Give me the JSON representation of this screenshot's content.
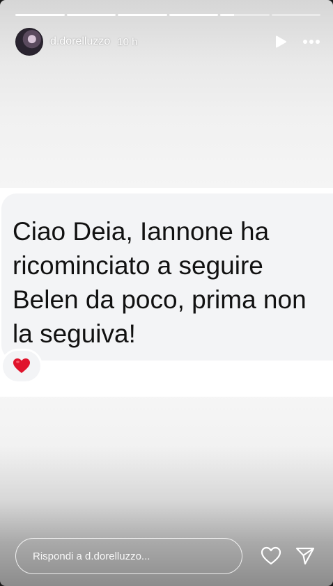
{
  "story": {
    "progress_segments": [
      1,
      1,
      1,
      1,
      0.28,
      0
    ],
    "user": {
      "username": "d.dorelluzzo",
      "time_ago": "10 h"
    },
    "message": {
      "text": "Ciao Deia, Iannone ha\nricominciato a seguire\nBelen da poco, prima non\nla seguiva!",
      "reaction": "❤️"
    },
    "reply": {
      "placeholder": "Rispondi a d.dorelluzzo..."
    },
    "icons": {
      "play": "play-icon",
      "more": "more-options-icon",
      "like": "heart-icon",
      "share": "send-icon"
    }
  }
}
